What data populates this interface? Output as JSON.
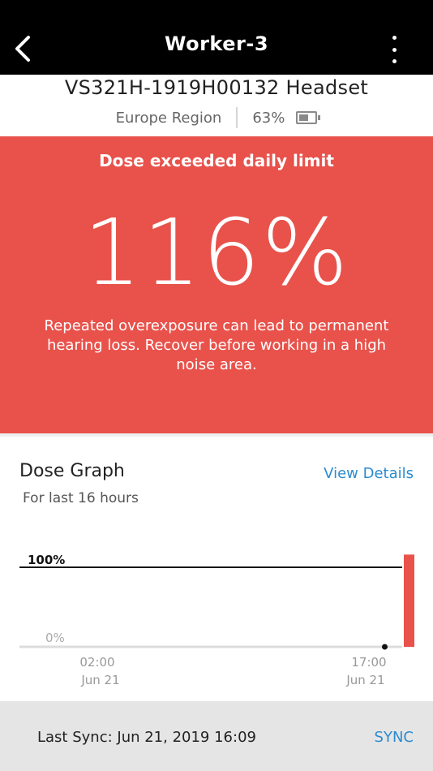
{
  "topbar": {
    "title": "Worker-3",
    "back_icon": "chevron-left-icon",
    "more_icon": "more-vertical-icon"
  },
  "device": {
    "name": "VS321H-1919H00132 Headset",
    "region": "Europe Region",
    "battery": "63%",
    "battery_fraction": 0.63
  },
  "alert": {
    "title": "Dose exceeded daily limit",
    "dose": "116%",
    "message": "Repeated overexposure can lead to permanent hearing loss. Recover before working in a high noise area.",
    "color": "#e8524b"
  },
  "graph": {
    "title": "Dose Graph",
    "view_details": "View Details",
    "subtitle": "For last 16 hours",
    "accent": "#2b8bd0"
  },
  "chart_data": {
    "type": "bar",
    "y_ticks": [
      "100%",
      "0%"
    ],
    "ylim": [
      0,
      100
    ],
    "limit_line": 100,
    "x_ticks": [
      {
        "time": "02:00",
        "date": "Jun 21"
      },
      {
        "time": "17:00",
        "date": "Jun 21"
      }
    ],
    "x_range_hours": [
      0,
      16
    ],
    "bar": {
      "hour": 16,
      "value": 116,
      "color": "#e8524b"
    },
    "marker": {
      "hour": 15
    }
  },
  "footer": {
    "last_sync": "Last Sync: Jun 21, 2019 16:09",
    "sync_label": "SYNC"
  }
}
